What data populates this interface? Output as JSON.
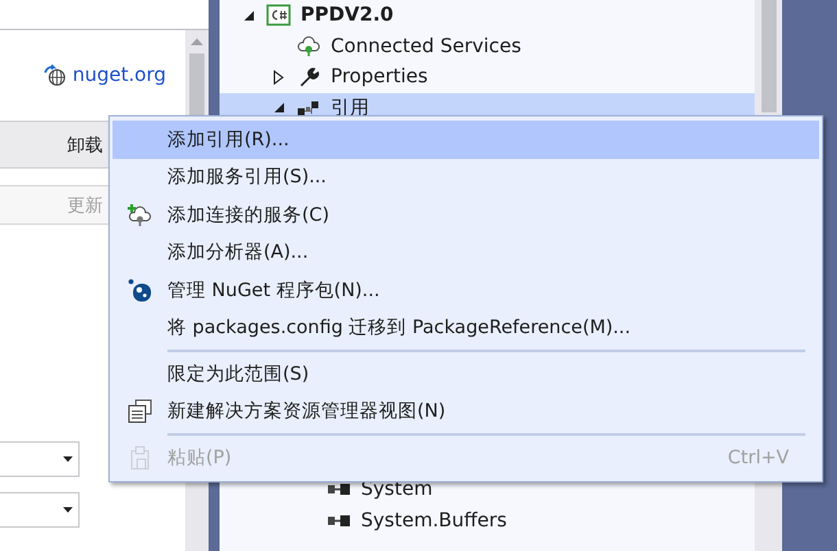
{
  "left_pane": {
    "link": "nuget.org",
    "header_button": "卸载",
    "update_button": {
      "label": "更新",
      "disabled": true
    }
  },
  "tree": [
    {
      "label": "PPDV2.0",
      "kind": "project",
      "expanded": true,
      "selected": false,
      "children": [
        {
          "label": "Connected Services",
          "kind": "service",
          "selected": false
        },
        {
          "label": "Properties",
          "kind": "properties",
          "expanded": false,
          "selected": false
        },
        {
          "label": "引用",
          "kind": "references",
          "expanded": true,
          "selected": true,
          "children": [
            {
              "label": "System",
              "kind": "assembly",
              "selected": false
            },
            {
              "label": "System.Buffers",
              "kind": "assembly",
              "selected": false
            }
          ]
        }
      ]
    }
  ],
  "context_menu": [
    {
      "kind": "item",
      "label": "添加引用(R)...",
      "selected": true,
      "disabled": false
    },
    {
      "kind": "item",
      "label": "添加服务引用(S)...",
      "selected": false,
      "disabled": false
    },
    {
      "kind": "item",
      "label": "添加连接的服务(C)",
      "selected": false,
      "disabled": false
    },
    {
      "kind": "item",
      "label": "添加分析器(A)...",
      "selected": false,
      "disabled": false
    },
    {
      "kind": "item",
      "label": "管理 NuGet 程序包(N)...",
      "selected": false,
      "disabled": false
    },
    {
      "kind": "item",
      "label": "将 packages.config 迁移到 PackageReference(M)...",
      "selected": false,
      "disabled": false
    },
    {
      "kind": "separator"
    },
    {
      "kind": "item",
      "label": "限定为此范围(S)",
      "selected": false,
      "disabled": false
    },
    {
      "kind": "item",
      "label": "新建解决方案资源管理器视图(N)",
      "selected": false,
      "disabled": false
    },
    {
      "kind": "separator"
    },
    {
      "kind": "item",
      "label": "粘贴(P)",
      "shortcut": "Ctrl+V",
      "selected": false,
      "disabled": true
    }
  ]
}
